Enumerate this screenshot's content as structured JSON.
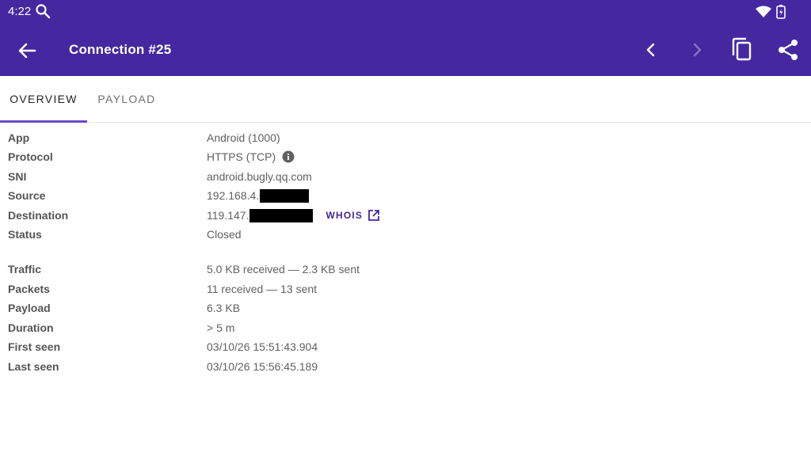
{
  "status_bar": {
    "time": "4:22",
    "icons": [
      "search-icon",
      "wifi-icon",
      "battery-charging-icon"
    ]
  },
  "app_bar": {
    "title": "Connection #25",
    "icons": [
      "back-arrow-icon",
      "chevron-left-icon",
      "chevron-right-icon",
      "copy-icon",
      "share-icon"
    ]
  },
  "tabs": [
    {
      "label": "OVERVIEW",
      "selected": true
    },
    {
      "label": "PAYLOAD",
      "selected": false
    }
  ],
  "details": {
    "app": {
      "label": "App",
      "value": "Android (1000)"
    },
    "protocol": {
      "label": "Protocol",
      "value": "HTTPS (TCP)"
    },
    "sni": {
      "label": "SNI",
      "value": "android.bugly.qq.com"
    },
    "source": {
      "label": "Source",
      "value": "192.168.4."
    },
    "destination": {
      "label": "Destination",
      "value": "119.147.",
      "whois": "WHOIS"
    },
    "status": {
      "label": "Status",
      "value": "Closed"
    },
    "traffic": {
      "label": "Traffic",
      "value": "5.0 KB received — 2.3 KB sent"
    },
    "packets": {
      "label": "Packets",
      "value": "11 received — 13 sent"
    },
    "payload": {
      "label": "Payload",
      "value": "6.3 KB"
    },
    "duration": {
      "label": "Duration",
      "value": "> 5 m"
    },
    "first_seen": {
      "label": "First seen",
      "value": "03/10/26 15:51:43.904"
    },
    "last_seen": {
      "label": "Last seen",
      "value": "03/10/26 15:56:45.189"
    }
  },
  "colors": {
    "app_bar": "#4527a0",
    "accent": "#6a4bc4",
    "label_text": "#555555",
    "value_text": "#616161"
  }
}
